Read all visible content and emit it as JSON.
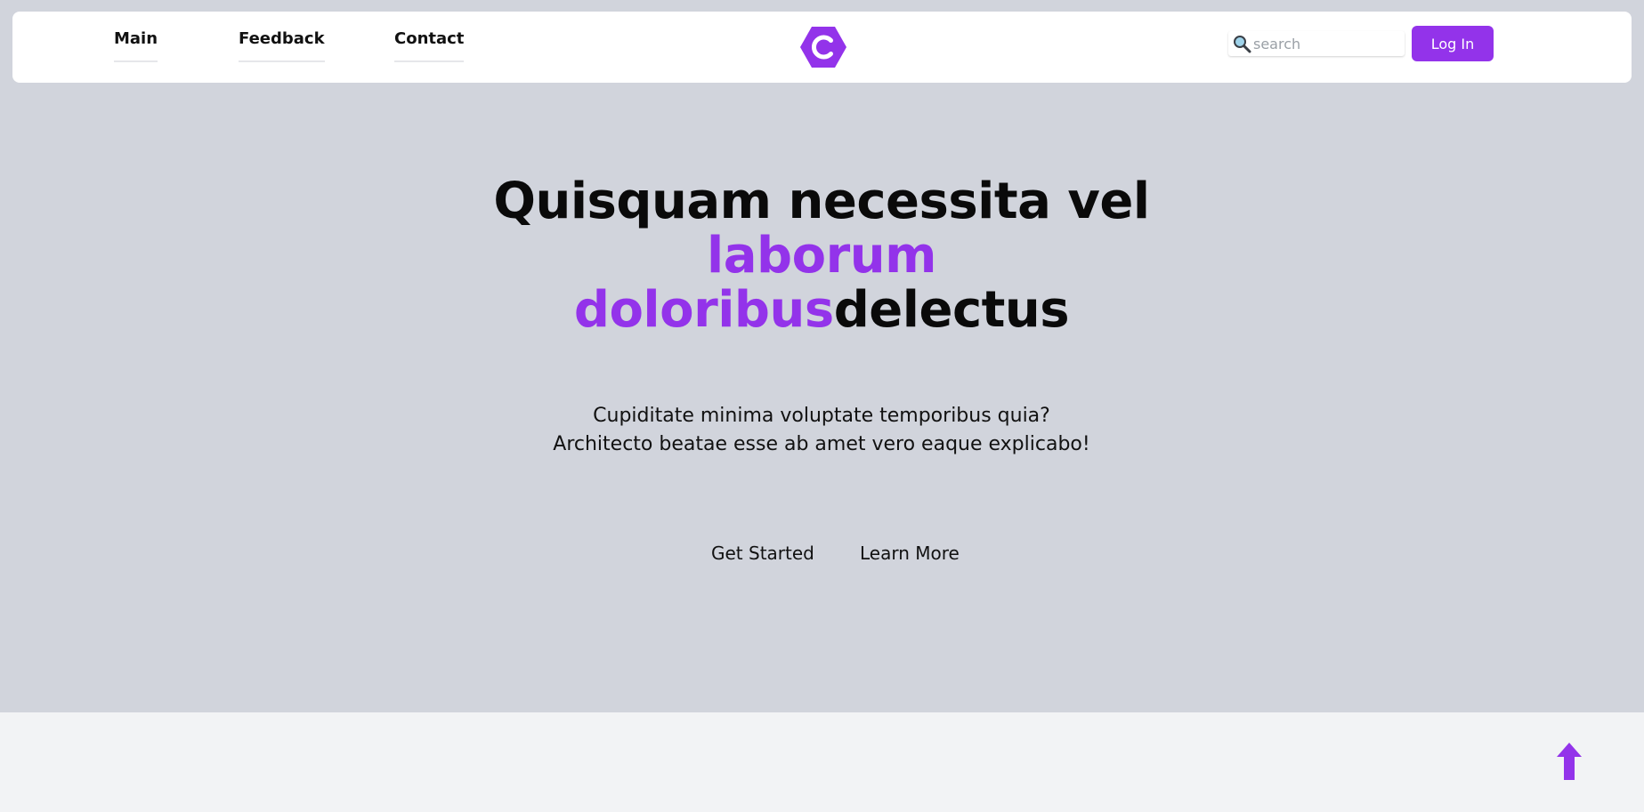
{
  "colors": {
    "accent": "#9333ea",
    "hero_background": "#d1d4dc",
    "lower_background": "#f2f3f5",
    "navbar_background": "#ffffff",
    "text": "#0a0a0a"
  },
  "nav": {
    "links": [
      {
        "label": "Main"
      },
      {
        "label": "Feedback"
      },
      {
        "label": "Contact"
      }
    ],
    "logo_icon": "hexagon-c-logo-icon",
    "search": {
      "icon": "magnifier-icon",
      "placeholder": "search",
      "value": ""
    },
    "login_label": "Log In"
  },
  "hero": {
    "headline": {
      "line1": "Quisquam necessita vel",
      "accent1": "laborum",
      "accent2": "doloribus",
      "tail": "delectus"
    },
    "subtext": {
      "line1": "Cupiditate minima voluptate temporibus quia?",
      "line2": "Architecto beatae esse ab amet vero eaque explicabo!"
    },
    "buttons": {
      "get_started": "Get Started",
      "learn_more": "Learn More"
    }
  },
  "scroll_top_icon": "arrow-up-icon"
}
